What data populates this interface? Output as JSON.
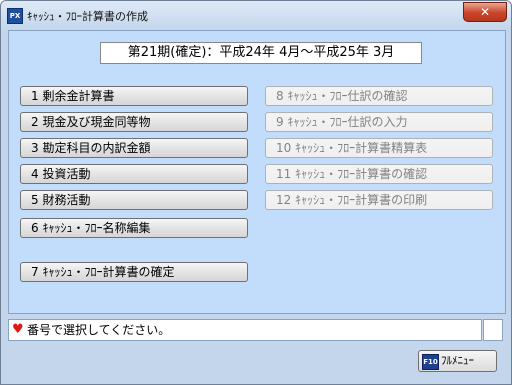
{
  "window": {
    "title": "ｷｬｯｼｭ・ﾌﾛｰ計算書の作成",
    "app_icon": "PX",
    "close_label": "✕"
  },
  "period": "第21期(確定)：平成24年 4月～平成25年 3月",
  "menu_left": [
    {
      "label": "1 剰余金計算書"
    },
    {
      "label": "2 現金及び現金同等物"
    },
    {
      "label": "3 勘定科目の内訳金額"
    },
    {
      "label": "4 投資活動"
    },
    {
      "label": "5 財務活動"
    },
    {
      "label": "6 ｷｬｯｼｭ・ﾌﾛｰ名称編集"
    },
    {
      "label": "7 ｷｬｯｼｭ・ﾌﾛｰ計算書の確定"
    }
  ],
  "menu_right": [
    {
      "label": "8 ｷｬｯｼｭ・ﾌﾛｰ仕訳の確認"
    },
    {
      "label": "9 ｷｬｯｼｭ・ﾌﾛｰ仕訳の入力"
    },
    {
      "label": "10 ｷｬｯｼｭ・ﾌﾛｰ計算書精算表"
    },
    {
      "label": "11 ｷｬｯｼｭ・ﾌﾛｰ計算書の確認"
    },
    {
      "label": "12 ｷｬｯｼｭ・ﾌﾛｰ計算書の印刷"
    }
  ],
  "message": {
    "icon": "heart-icon",
    "text": "番号で選択してください。"
  },
  "footer": {
    "fkey": "F10",
    "fullmenu_label": "ﾌﾙﾒﾆｭｰ"
  }
}
